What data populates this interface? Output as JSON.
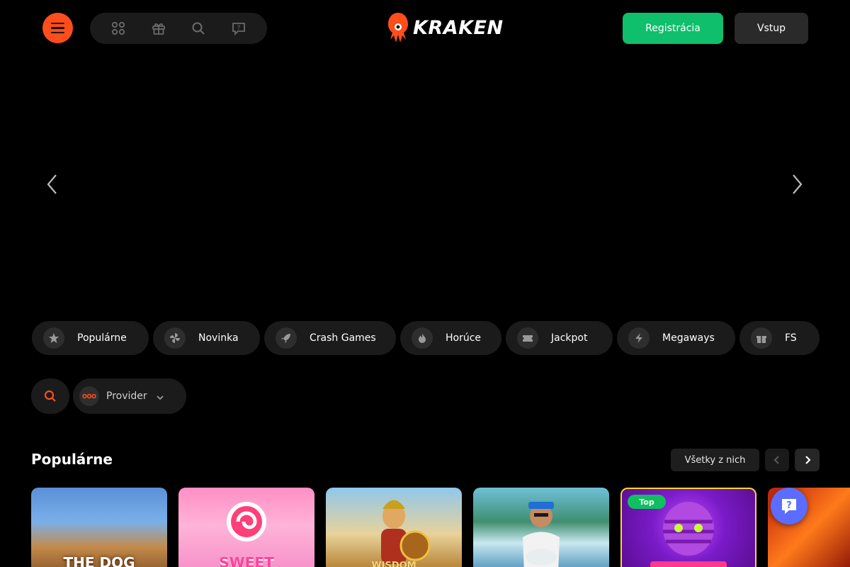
{
  "header": {
    "menu_icon": "hamburger-icon",
    "quick_icons": [
      "grid-icon",
      "gift-icon",
      "search-icon",
      "help-chat-icon"
    ],
    "logo_text": "KRAKEN",
    "register_label": "Registrácia",
    "login_label": "Vstup"
  },
  "banner": {
    "prev_icon": "chevron-left-icon",
    "next_icon": "chevron-right-icon"
  },
  "categories": [
    {
      "label": "Populárne",
      "icon": "star-icon"
    },
    {
      "label": "Novinka",
      "icon": "pinwheel-icon"
    },
    {
      "label": "Crash Games",
      "icon": "rocket-icon"
    },
    {
      "label": "Horúce",
      "icon": "flame-icon"
    },
    {
      "label": "Jackpot",
      "icon": "ticket-icon"
    },
    {
      "label": "Megaways",
      "icon": "lightning-icon"
    },
    {
      "label": "FS",
      "icon": "gift-icon"
    }
  ],
  "filters": {
    "search_icon": "search-icon",
    "provider_label": "Provider"
  },
  "section": {
    "title": "Populárne",
    "see_all_label": "Všetky z nich"
  },
  "games": [
    {
      "art_text": "THE DOG"
    },
    {
      "art_text": "SWEET"
    },
    {
      "art_text": "WISDOM"
    },
    {
      "art_text": ""
    },
    {
      "art_text": "",
      "badge": "Top"
    },
    {
      "art_text": ""
    }
  ],
  "colors": {
    "accent": "#ff4e1b",
    "register": "#0fbf6b",
    "help": "#5b6cff"
  }
}
